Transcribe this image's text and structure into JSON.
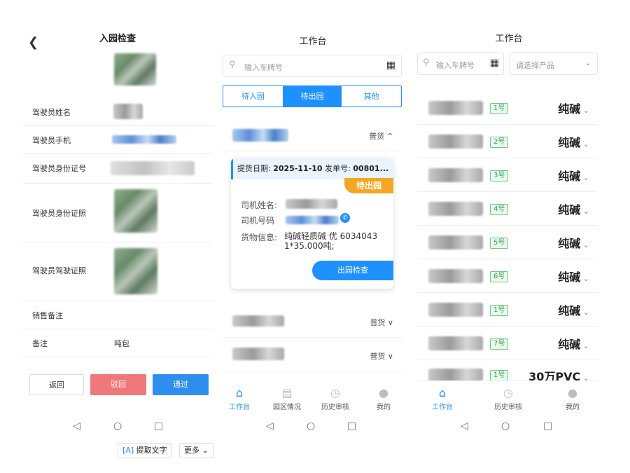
{
  "screen1": {
    "title": "入园检查",
    "back_icon": "chevron-left-icon",
    "fields": [
      {
        "label": "驾驶员姓名"
      },
      {
        "label": "驾驶员手机"
      },
      {
        "label": "驾驶员身份证号"
      },
      {
        "label": "驾驶员身份证照"
      },
      {
        "label": "驾驶员驾驶证照"
      },
      {
        "label": "销售备注"
      },
      {
        "label": "备注",
        "value": "吨包"
      }
    ],
    "buttons": {
      "back": "返回",
      "reject": "驳回",
      "pass": "通过"
    },
    "buttons_colors": {
      "reject": "#f0787a",
      "pass": "#2e8ef0"
    },
    "bottom_tools": {
      "extract_text": "提取文字",
      "more": "更多"
    }
  },
  "screen2": {
    "title": "工作台",
    "search_placeholder": "输入车牌号",
    "tabs": [
      "待入园",
      "待出园",
      "其他"
    ],
    "active_tab": "待出园",
    "first_item_tag": "普货 ^",
    "card": {
      "date_label": "提货日期:",
      "date_value": "2025-11-10",
      "order_label": "发单号:",
      "order_value": "00801...",
      "status_badge": "待出园",
      "driver_name_label": "司机姓名:",
      "driver_phone_label": "司机号码",
      "goods_label": "货物信息:",
      "goods_value": "纯碱轻质碱 优 6034043 1*35.000吨;",
      "action_button": "出园检查"
    },
    "list_tags": [
      "普货 ∨",
      "普货 ∨"
    ],
    "tabbar": [
      "工作台",
      "园区情况",
      "历史审核",
      "我的"
    ]
  },
  "screen3": {
    "title": "工作台",
    "search_placeholder": "输入车牌号",
    "product_select_placeholder": "请选择产品",
    "rows": [
      {
        "badge": "1号",
        "product": "纯碱"
      },
      {
        "badge": "2号",
        "product": "纯碱"
      },
      {
        "badge": "3号",
        "product": "纯碱"
      },
      {
        "badge": "4号",
        "product": "纯碱"
      },
      {
        "badge": "5号",
        "product": "纯碱"
      },
      {
        "badge": "6号",
        "product": "纯碱"
      },
      {
        "badge": "1号",
        "product": "纯碱"
      },
      {
        "badge": "7号",
        "product": "纯碱"
      },
      {
        "badge": "1号",
        "product": "30万PVC"
      }
    ],
    "tabbar": [
      "工作台",
      "历史审核",
      "我的"
    ]
  },
  "colors": {
    "accent": "#1e90ff",
    "status_orange": "#f5a623"
  }
}
